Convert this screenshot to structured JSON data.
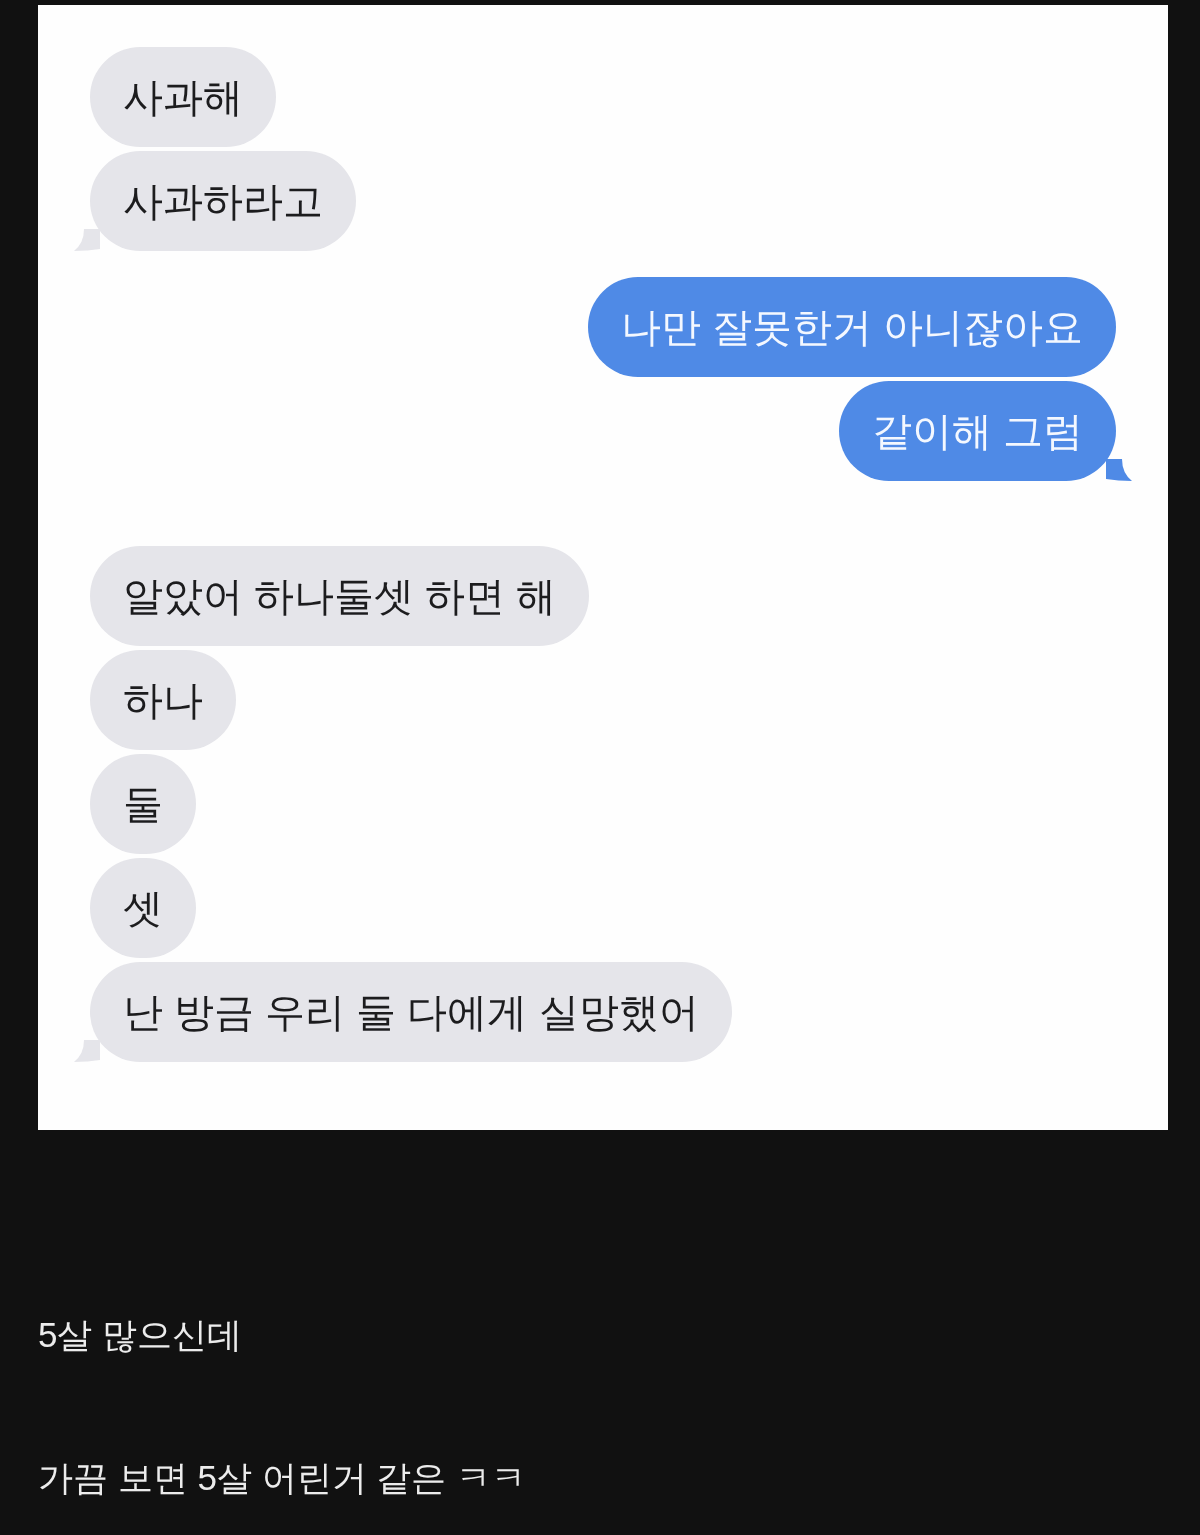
{
  "chat_screenshot": {
    "messages": [
      {
        "kind": "incoming",
        "text": "사과해",
        "tail": false
      },
      {
        "kind": "incoming",
        "text": "사과하라고",
        "tail": true
      },
      {
        "kind": "outgoing",
        "text": "나만 잘못한거 아니잖아요",
        "tail": false
      },
      {
        "kind": "outgoing",
        "text": "같이해 그럼",
        "tail": true
      },
      {
        "kind": "incoming",
        "text": "알았어 하나둘셋 하면 해",
        "tail": false
      },
      {
        "kind": "incoming",
        "text": "하나",
        "tail": false
      },
      {
        "kind": "incoming",
        "text": "둘",
        "tail": false
      },
      {
        "kind": "incoming",
        "text": "셋",
        "tail": false
      },
      {
        "kind": "incoming",
        "text": "난 방금 우리 둘 다에게 실망했어",
        "tail": true
      }
    ]
  },
  "comments": [
    {
      "text": "5살 많으신데"
    },
    {
      "text": "가끔 보면 5살 어린거 같은 ㅋㅋ"
    }
  ]
}
